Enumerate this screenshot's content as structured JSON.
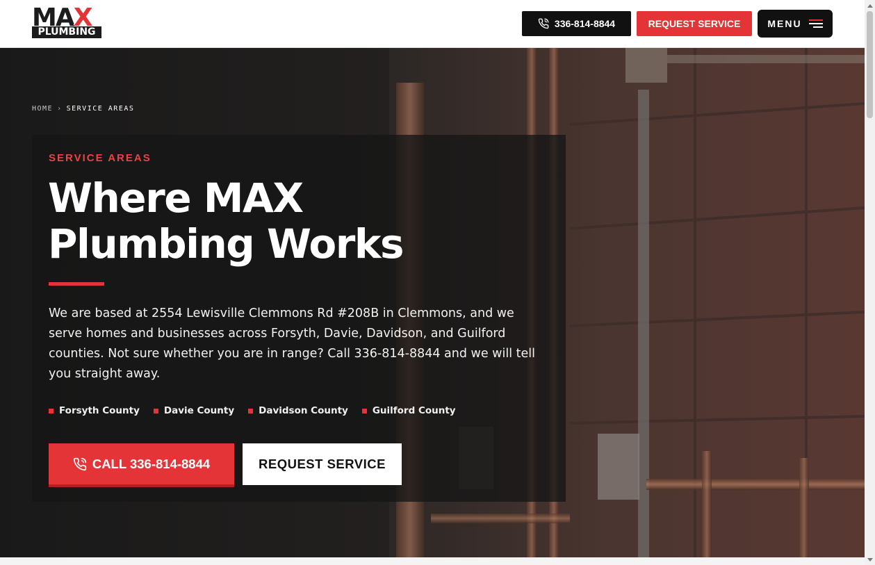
{
  "header": {
    "logo_top": "MAX",
    "logo_bottom": "PLUMBING",
    "phone_label": "336-814-8844",
    "request_label": "REQUEST SERVICE",
    "menu_label": "MENU"
  },
  "breadcrumb": {
    "home": "HOME",
    "separator": "›",
    "current": "SERVICE AREAS"
  },
  "hero": {
    "eyebrow": "SERVICE AREAS",
    "title": "Where MAX Plumbing Works",
    "description": "We are based at 2554 Lewisville Clemmons Rd #208B in Clemmons, and we serve homes and businesses across Forsyth, Davie, Davidson, and Guilford counties. Not sure whether you are in range? Call 336-814-8844 and we will tell you straight away.",
    "counties": [
      "Forsyth County",
      "Davie County",
      "Davidson County",
      "Guilford County"
    ],
    "cta_call": "CALL 336-814-8844",
    "cta_request": "REQUEST SERVICE"
  },
  "colors": {
    "accent": "#e53437",
    "dark": "#111111",
    "panel": "#161616"
  },
  "icons": {
    "phone": "phone-icon",
    "menu": "hamburger-icon"
  }
}
